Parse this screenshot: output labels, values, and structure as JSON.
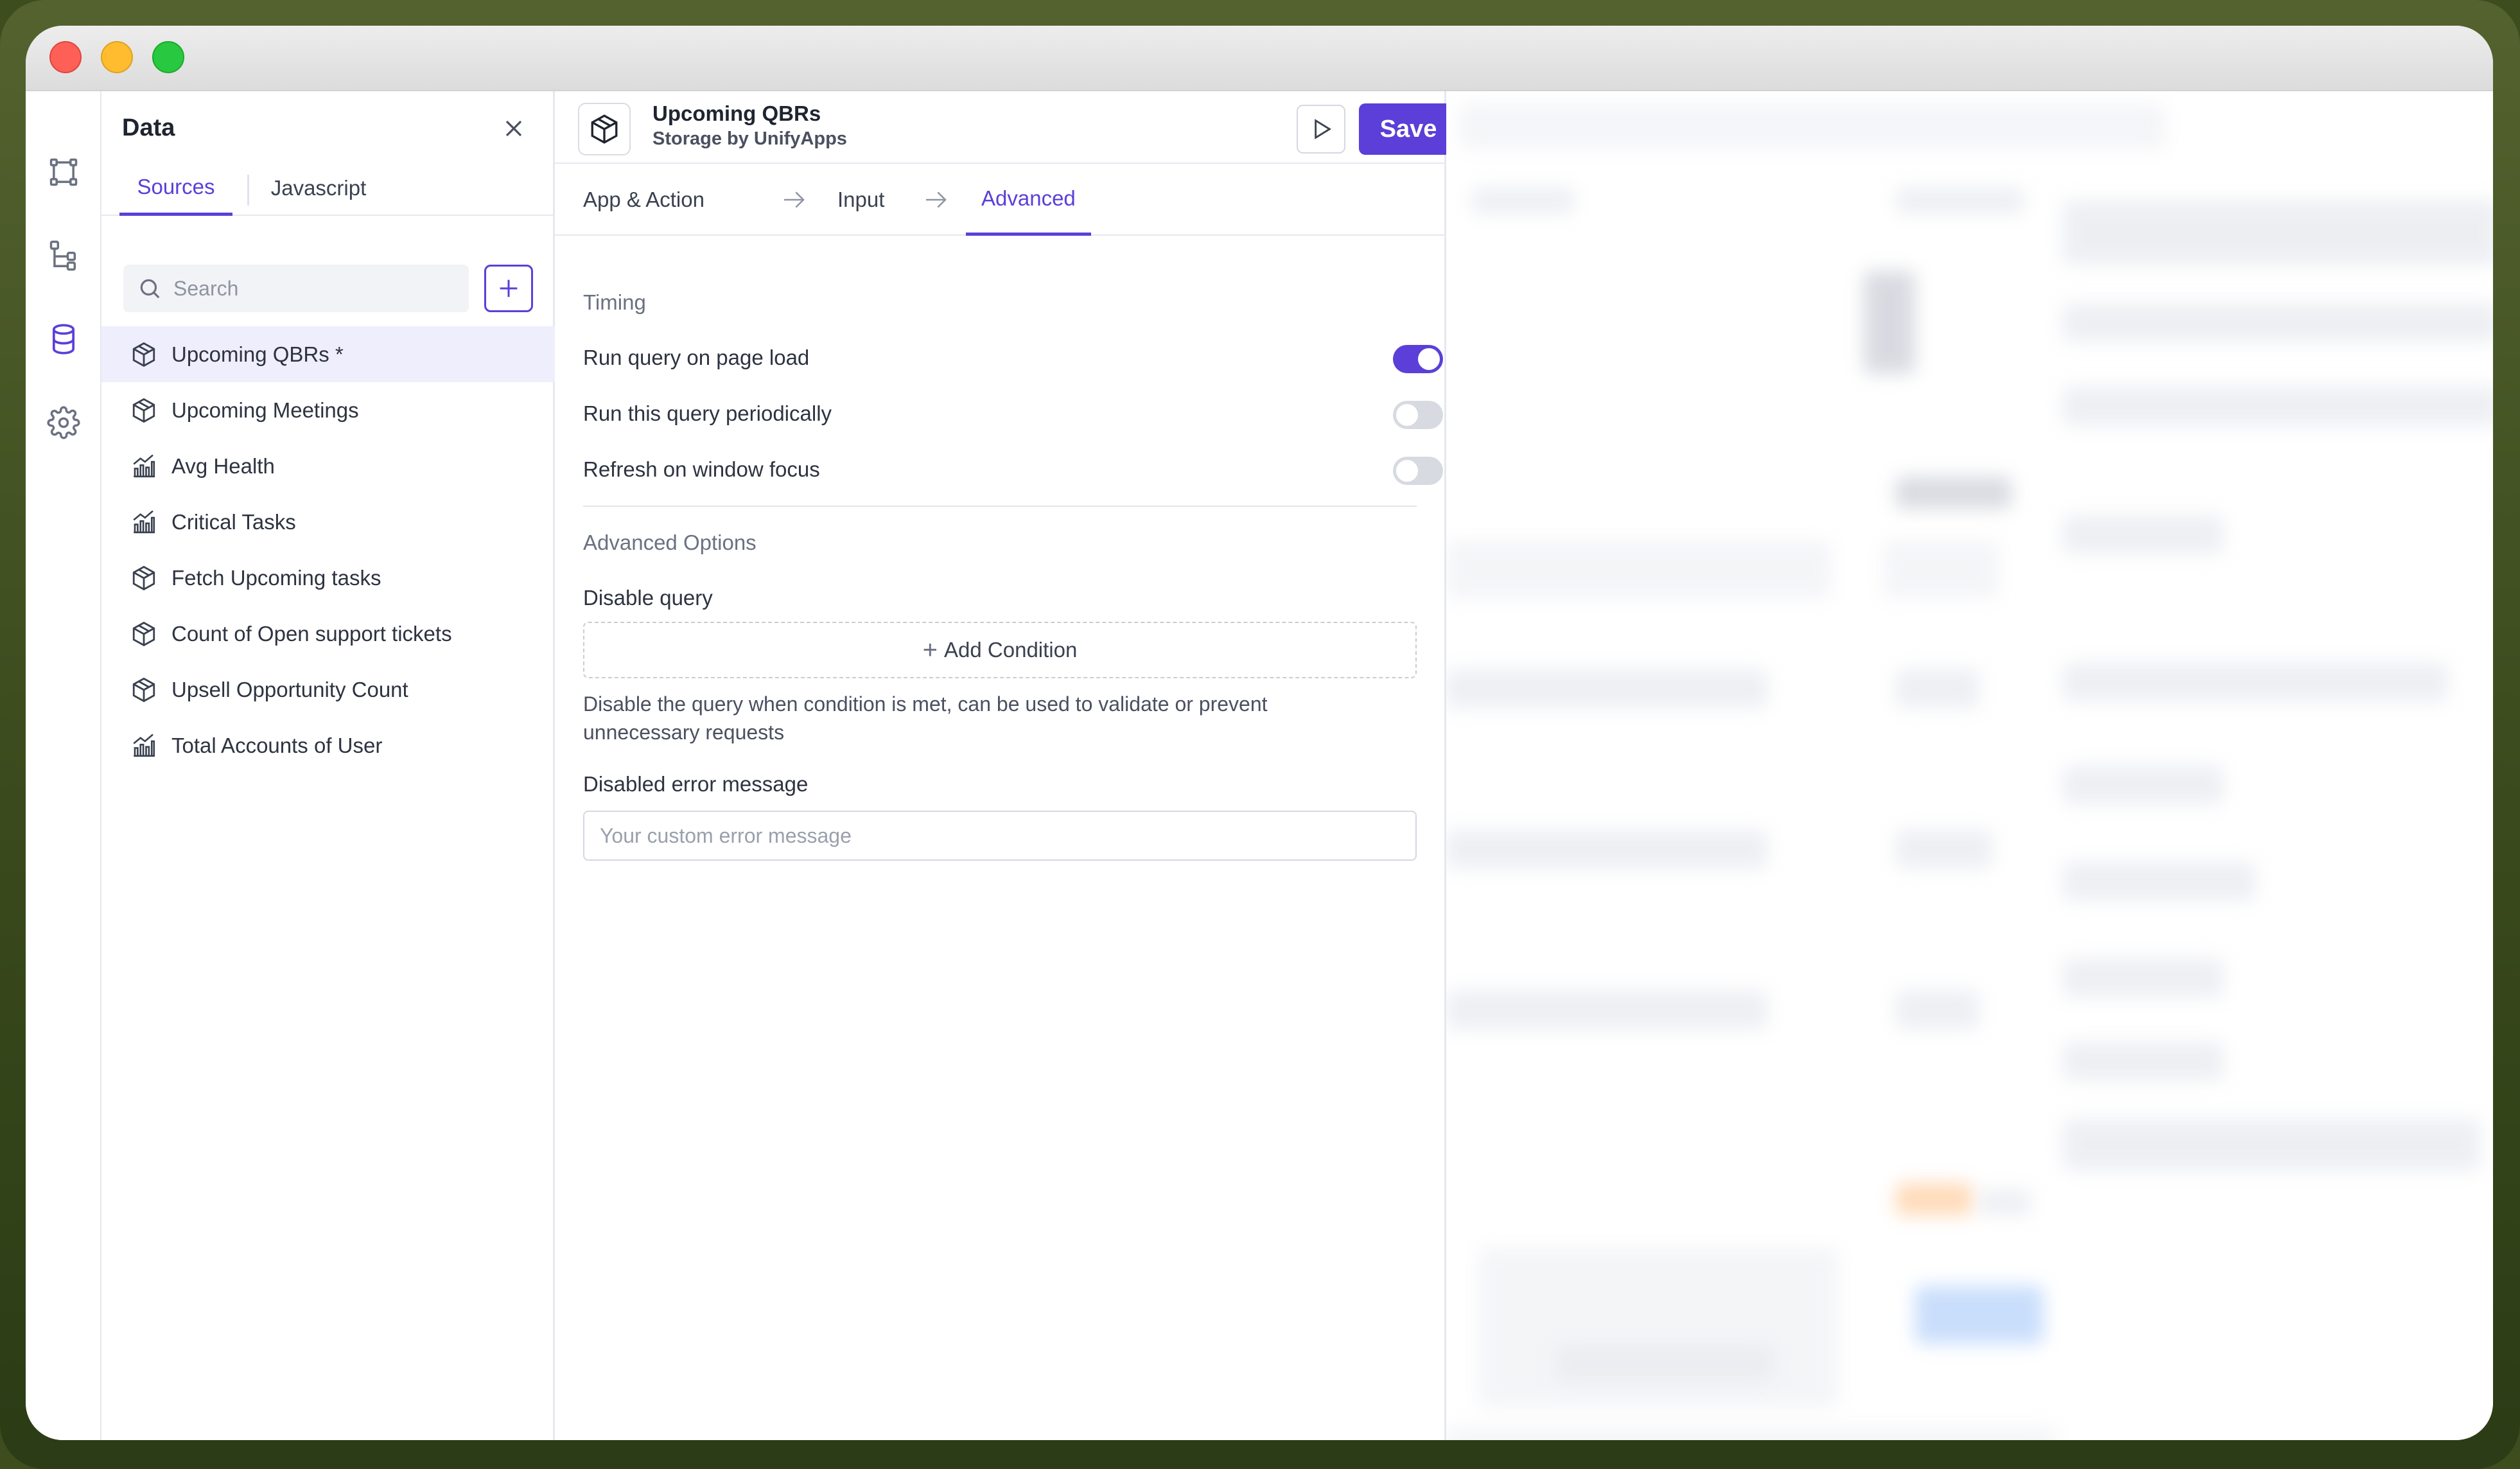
{
  "window": {
    "traffic_lights": [
      "close",
      "minimize",
      "maximize"
    ]
  },
  "rail": {
    "items": [
      {
        "name": "layout-icon",
        "active": false
      },
      {
        "name": "tree-icon",
        "active": false
      },
      {
        "name": "database-icon",
        "active": true
      },
      {
        "name": "gear-icon",
        "active": false
      }
    ]
  },
  "data_panel": {
    "title": "Data",
    "tabs": [
      {
        "label": "Sources",
        "active": true
      },
      {
        "label": "Javascript",
        "active": false
      }
    ],
    "search": {
      "placeholder": "Search",
      "value": ""
    },
    "add_label": "+",
    "items": [
      {
        "label": "Upcoming QBRs *",
        "icon": "cube-icon",
        "selected": true
      },
      {
        "label": "Upcoming Meetings",
        "icon": "cube-icon",
        "selected": false
      },
      {
        "label": "Avg Health",
        "icon": "chart-icon",
        "selected": false
      },
      {
        "label": "Critical Tasks",
        "icon": "chart-icon",
        "selected": false
      },
      {
        "label": "Fetch Upcoming tasks",
        "icon": "cube-icon",
        "selected": false
      },
      {
        "label": "Count of Open support tickets",
        "icon": "cube-icon",
        "selected": false
      },
      {
        "label": "Upsell Opportunity Count",
        "icon": "cube-icon",
        "selected": false
      },
      {
        "label": "Total Accounts of User",
        "icon": "chart-icon",
        "selected": false
      }
    ]
  },
  "editor": {
    "query_name": "Upcoming QBRs",
    "query_source": "Storage by UnifyApps",
    "save_label": "Save",
    "steps": [
      {
        "label": "App & Action",
        "active": false
      },
      {
        "label": "Input",
        "active": false
      },
      {
        "label": "Advanced",
        "active": true
      }
    ],
    "timing": {
      "section_label": "Timing",
      "options": [
        {
          "label": "Run query on page load",
          "enabled": true
        },
        {
          "label": "Run this query periodically",
          "enabled": false
        },
        {
          "label": "Refresh on window focus",
          "enabled": false
        }
      ]
    },
    "advanced": {
      "section_label": "Advanced Options",
      "disable_query_label": "Disable query",
      "add_condition_label": "Add Condition",
      "help_text": "Disable the query when condition is met, can be used to validate or prevent unnecessary requests",
      "error_message_label": "Disabled error message",
      "error_message_placeholder": "Your custom error message",
      "error_message_value": ""
    }
  },
  "colors": {
    "accent": "#5b3fd8",
    "selected_bg": "#efeefd",
    "border": "#e6e8ee"
  }
}
